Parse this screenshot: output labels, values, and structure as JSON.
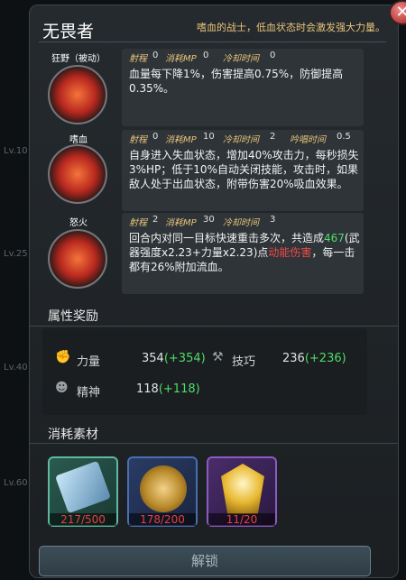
{
  "levels": [
    "Lv.10",
    "Lv.25",
    "Lv.40",
    "Lv.60"
  ],
  "panel": {
    "title": "无畏者",
    "subtitle": "嗜血的战士，低血状态时会激发强大力量。",
    "close": "✕"
  },
  "skills": [
    {
      "name": "狂野（被动）",
      "range_label": "射程",
      "range": "0",
      "mp_label": "消耗MP",
      "mp": "0",
      "cd_label": "冷却时间",
      "cd": "0",
      "desc": "血量每下降1%，伤害提高0.75%，防御提高0.35%。"
    },
    {
      "name": "嗜血",
      "range_label": "射程",
      "range": "0",
      "mp_label": "消耗MP",
      "mp": "10",
      "cd_label": "冷却时间",
      "cd": "2",
      "cast_label": "吟唱时间",
      "cast": "0.5",
      "desc": "自身进入失血状态，增加40%攻击力，每秒损失3%HP；低于10%自动关闭技能，攻击时，如果敌人处于出血状态，附带伤害20%吸血效果。"
    },
    {
      "name": "怒火",
      "range_label": "射程",
      "range": "2",
      "mp_label": "消耗MP",
      "mp": "30",
      "cd_label": "冷却时间",
      "cd": "3",
      "desc_a": "回合内对同一目标快速重击多次，共造成",
      "desc_num": "467",
      "desc_b": "(武器强度x2.23+力量x2.23)点",
      "desc_red": "动能伤害",
      "desc_c": "，每一击都有26%附加流血。"
    }
  ],
  "attributes": {
    "heading": "属性奖励",
    "strength": {
      "label": "力量",
      "value": "354",
      "bonus": "(+354)"
    },
    "skill": {
      "label": "技巧",
      "value": "236",
      "bonus": "(+236)"
    },
    "spirit": {
      "label": "精神",
      "value": "118",
      "bonus": "(+118)"
    }
  },
  "materials": {
    "heading": "消耗素材",
    "items": [
      {
        "icon": "data-card-icon",
        "count": "217/500",
        "border": "#5fb8a0"
      },
      {
        "icon": "golden-sphere-icon",
        "count": "178/200",
        "border": "#4a6fb0"
      },
      {
        "icon": "golden-crest-icon",
        "count": "11/20",
        "border": "#8a5cc0"
      }
    ]
  },
  "unlock_button": "解锁"
}
